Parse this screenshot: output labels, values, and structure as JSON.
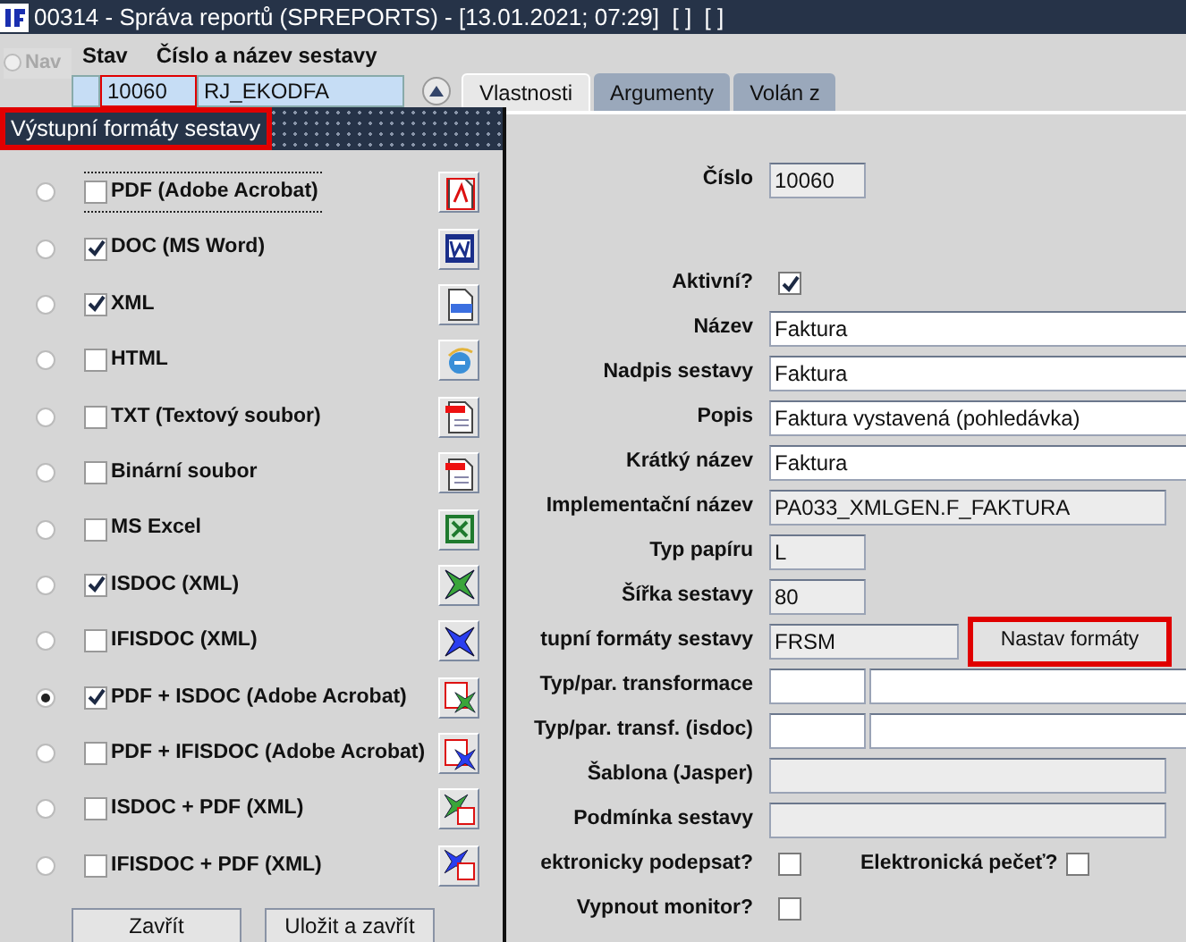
{
  "window": {
    "title": "00314 - Správa reportů (SPREPORTS) - [13.01.2021; 07:29]  [ ]  [ ]"
  },
  "nav": {
    "label": "Nav",
    "disabled": true
  },
  "header": {
    "stav_label": "Stav",
    "name_label": "Číslo a název sestavy",
    "number": "10060",
    "name": "RJ_EKODFA"
  },
  "tabs": [
    {
      "label": "Vlastnosti",
      "selected": true
    },
    {
      "label": "Argumenty",
      "selected": false
    },
    {
      "label": "Volán z",
      "selected": false
    }
  ],
  "dialog": {
    "title": "Výstupní formáty sestavy",
    "formats": [
      {
        "kind": "pdf",
        "label": "PDF (Adobe Acrobat)",
        "selected": false,
        "checked": false,
        "focused": true
      },
      {
        "kind": "word",
        "label": "DOC (MS Word)",
        "selected": false,
        "checked": true,
        "focused": false
      },
      {
        "kind": "xml",
        "label": "XML",
        "selected": false,
        "checked": true,
        "focused": false
      },
      {
        "kind": "html",
        "label": "HTML",
        "selected": false,
        "checked": false,
        "focused": false
      },
      {
        "kind": "txt",
        "label": "TXT (Textový soubor)",
        "selected": false,
        "checked": false,
        "focused": false
      },
      {
        "kind": "bin",
        "label": "Binární soubor",
        "selected": false,
        "checked": false,
        "focused": false
      },
      {
        "kind": "excel",
        "label": "MS Excel",
        "selected": false,
        "checked": false,
        "focused": false
      },
      {
        "kind": "isdoc",
        "label": "ISDOC (XML)",
        "selected": false,
        "checked": true,
        "focused": false
      },
      {
        "kind": "ifisdoc",
        "label": "IFISDOC (XML)",
        "selected": false,
        "checked": false,
        "focused": false
      },
      {
        "kind": "pdf_isdoc",
        "label": "PDF + ISDOC (Adobe Acrobat)",
        "selected": true,
        "checked": true,
        "focused": false
      },
      {
        "kind": "pdf_ifisdoc",
        "label": "PDF + IFISDOC (Adobe Acrobat)",
        "selected": false,
        "checked": false,
        "focused": false
      },
      {
        "kind": "isdoc_pdf",
        "label": "ISDOC + PDF (XML)",
        "selected": false,
        "checked": false,
        "focused": false
      },
      {
        "kind": "ifisdoc_pdf",
        "label": "IFISDOC + PDF (XML)",
        "selected": false,
        "checked": false,
        "focused": false
      }
    ],
    "buttons": [
      "Zavřít",
      "Uložit a zavřít"
    ]
  },
  "form": {
    "rows": [
      {
        "kind": "short",
        "label": "Číslo",
        "value": "10060"
      },
      {
        "kind": "check",
        "label": "Aktivní?",
        "checked": true
      },
      {
        "kind": "text",
        "label": "Název",
        "value": "Faktura"
      },
      {
        "kind": "text",
        "label": "Nadpis sestavy",
        "value": "Faktura"
      },
      {
        "kind": "text",
        "label": "Popis",
        "value": "Faktura vystavená (pohledávka)"
      },
      {
        "kind": "text",
        "label": "Krátký název",
        "value": "Faktura"
      },
      {
        "kind": "wide",
        "label": "Implementační název",
        "value": "PA033_XMLGEN.F_FAKTURA"
      },
      {
        "kind": "short",
        "label": "Typ papíru",
        "value": "L"
      },
      {
        "kind": "short",
        "label": "Šířka sestavy",
        "value": "80"
      },
      {
        "kind": "action",
        "label": "tupní formáty sestavy",
        "value": "FRSM",
        "button": "Nastav formáty"
      },
      {
        "kind": "pair",
        "label": "Typ/par. transformace"
      },
      {
        "kind": "pair",
        "label": "Typ/par. transf. (isdoc)"
      },
      {
        "kind": "wide",
        "label": "Šablona (Jasper)"
      },
      {
        "kind": "wide",
        "label": "Podmínka sestavy"
      },
      {
        "kind": "checks",
        "label": "ektronicky podepsat?",
        "checked": false,
        "label2": "Elektronická pečeť?",
        "checked2": false
      },
      {
        "kind": "check",
        "label": "Vypnout monitor?",
        "checked": false
      }
    ]
  }
}
